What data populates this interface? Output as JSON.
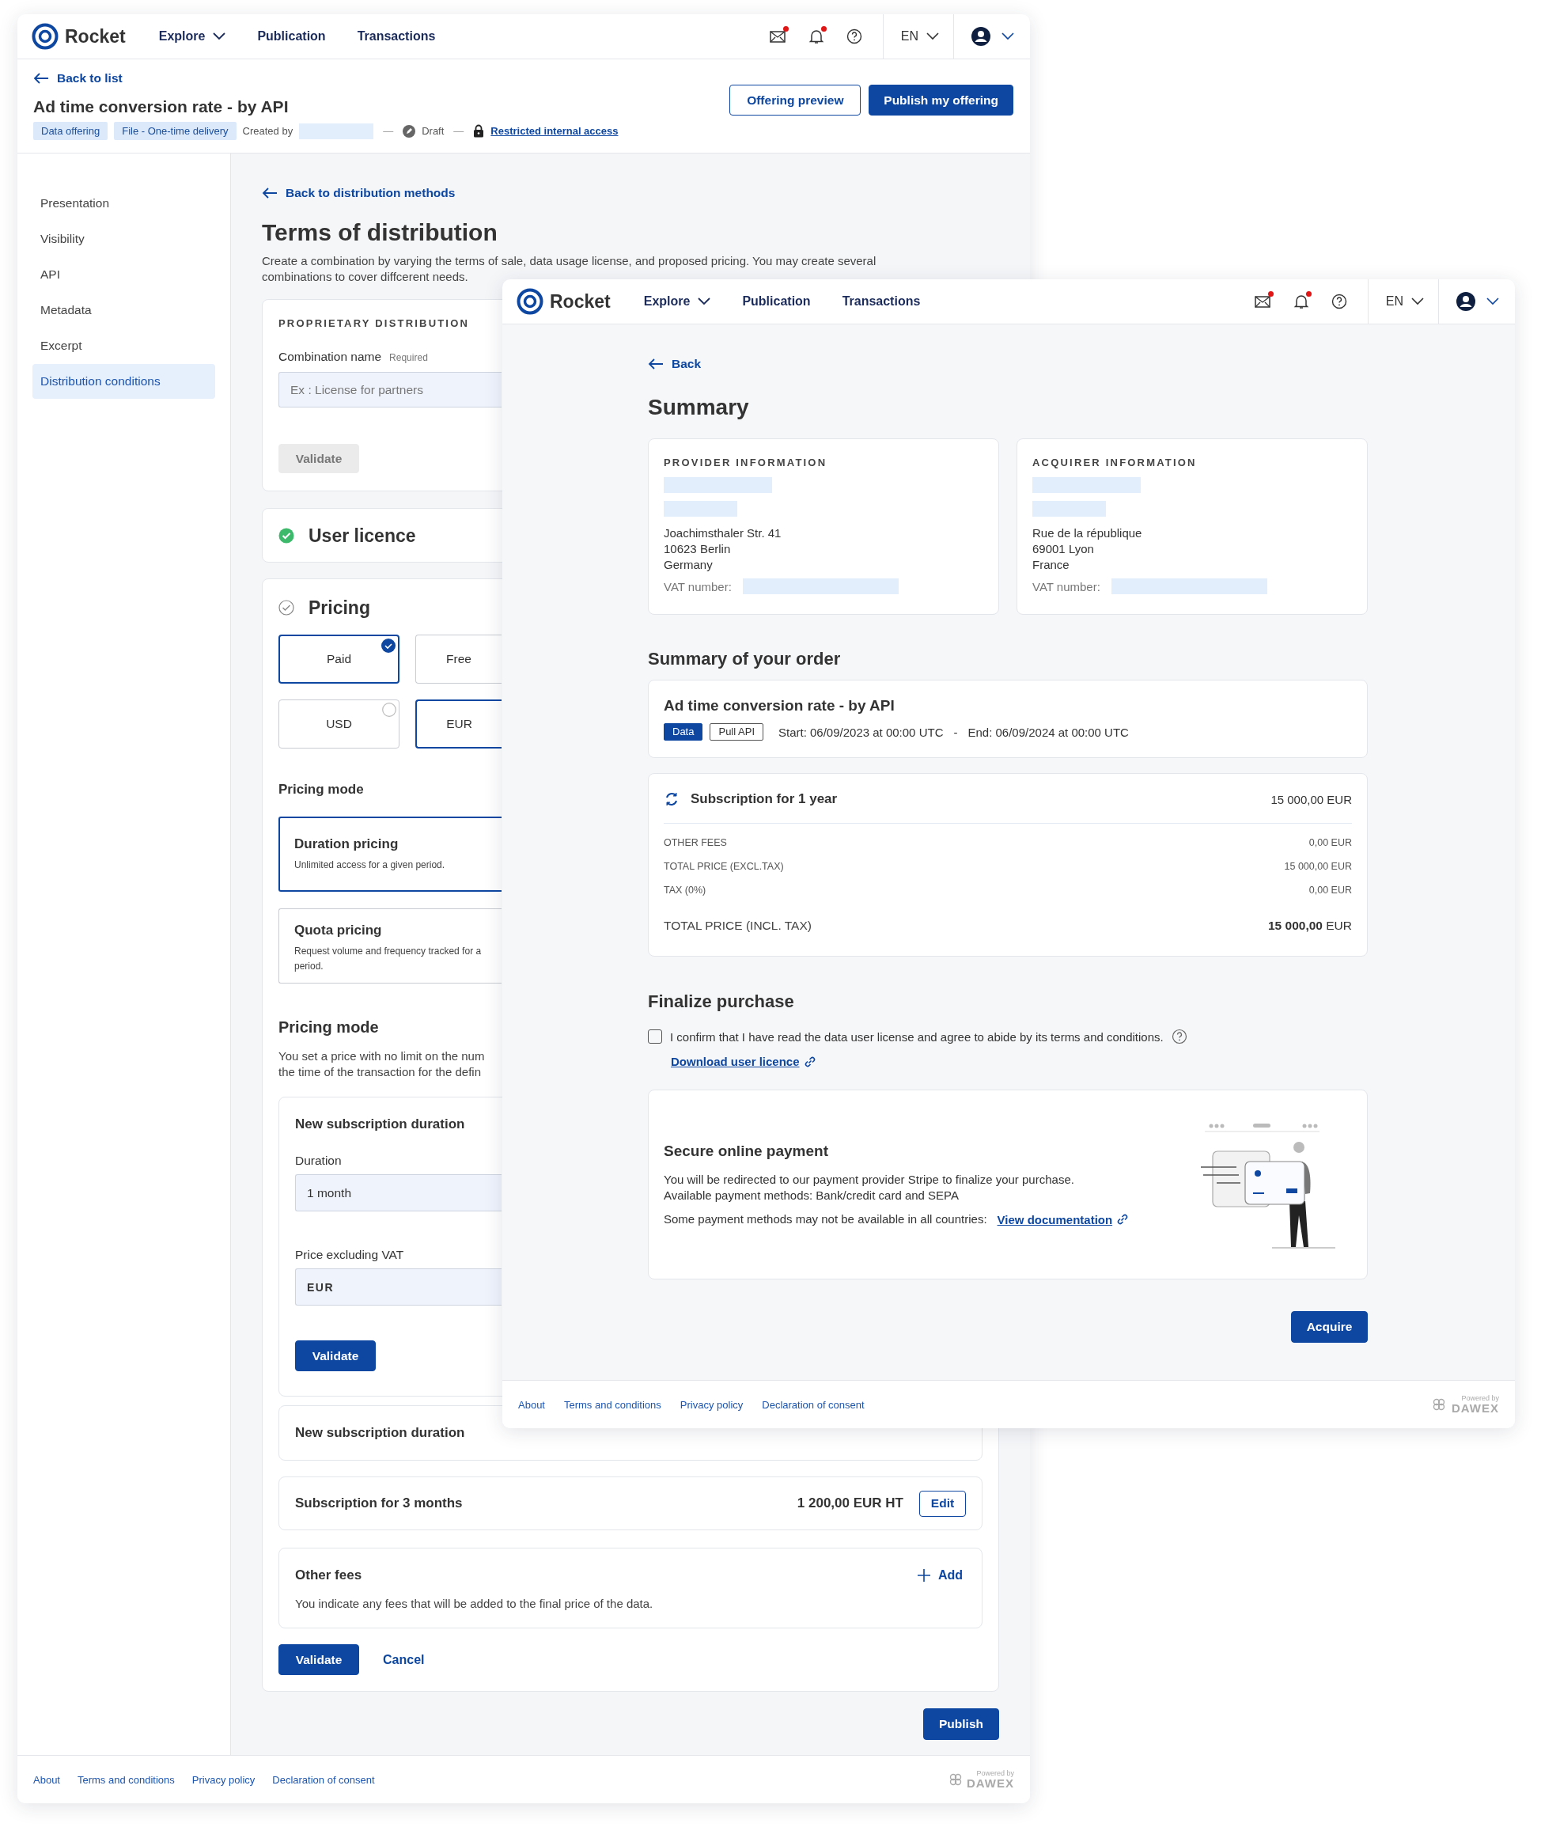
{
  "back_window": {
    "header": {
      "brand": "Rocket",
      "nav": [
        {
          "label": "Explore",
          "dropdown": true
        },
        {
          "label": "Publication",
          "dropdown": false
        },
        {
          "label": "Transactions",
          "dropdown": false
        }
      ],
      "icons": [
        {
          "kind": "mail",
          "unread": true
        },
        {
          "kind": "bell",
          "unread": true
        },
        {
          "kind": "help",
          "unread": false
        }
      ],
      "language": "EN"
    },
    "subheader": {
      "back_link": "Back to list",
      "title": "Ad time conversion rate - by API",
      "meta": [
        {
          "kind": "tag",
          "text": "Data offering"
        },
        {
          "kind": "tag",
          "text": "File - One-time delivery"
        },
        {
          "kind": "label",
          "text": "Created by"
        },
        {
          "kind": "redacted"
        },
        {
          "kind": "separator",
          "text": "—"
        },
        {
          "kind": "status",
          "text": "Draft"
        },
        {
          "kind": "separator",
          "text": "—"
        },
        {
          "kind": "access",
          "text": "Restricted internal access"
        }
      ],
      "buttons": [
        {
          "label": "Offering preview",
          "kind": "outline"
        },
        {
          "label": "Publish my offering",
          "kind": "primary"
        }
      ]
    },
    "sidebar": [
      {
        "label": "Presentation",
        "selected": false
      },
      {
        "label": "Visibility",
        "selected": false
      },
      {
        "label": "API",
        "selected": false
      },
      {
        "label": "Metadata",
        "selected": false
      },
      {
        "label": "Excerpt",
        "selected": false
      },
      {
        "label": "Distribution conditions",
        "selected": true
      }
    ],
    "main": {
      "back_link": "Back to distribution methods",
      "title": "Terms of distribution",
      "intro": "Create a combination by varying the terms of sale, data usage license, and proposed pricing. You may create several combinations to cover diffcerent needs."
    },
    "proprietary": {
      "heading": "PROPRIETARY DISTRIBUTION",
      "field_label": "Combination name",
      "required": "Required",
      "placeholder": "Ex : License for partners",
      "button": "Validate",
      "button_disabled": true
    },
    "user_licence": {
      "title": "User licence",
      "done": true
    },
    "pricing": {
      "title": "Pricing",
      "done": false,
      "options": [
        {
          "label": "Paid",
          "selected": true
        },
        {
          "label": "Free",
          "selected": false
        }
      ],
      "currencies": [
        {
          "label": "USD",
          "selected": false
        },
        {
          "label": "EUR",
          "selected": true
        }
      ],
      "mode_heading": "Pricing mode",
      "modes": [
        {
          "title": "Duration pricing",
          "lines": [
            "Unlimited access for a given period."
          ],
          "selected": true
        },
        {
          "title": "Quota pricing",
          "lines": [
            "Request volume and frequency tracked for a",
            "period."
          ],
          "selected": false
        }
      ],
      "mode2_heading": "Pricing mode",
      "mode2_lines": [
        "You set a price with no limit on the num",
        "the time of the transaction for the defin"
      ],
      "new_subscription": {
        "title": "New subscription duration",
        "duration_label": "Duration",
        "duration_value": "1 month",
        "price_label": "Price excluding VAT",
        "currency": "EUR",
        "button": "Validate"
      },
      "collapsed_title": "New subscription duration",
      "subscription": {
        "title": "Subscription for 3 months",
        "price": "1 200,00 EUR HT",
        "button": "Edit"
      },
      "other_fees": {
        "title": "Other fees",
        "add": "Add",
        "text": "You indicate any fees that will be added to the final price of the data."
      },
      "buttons": [
        {
          "label": "Validate",
          "kind": "primary"
        },
        {
          "label": "Cancel",
          "kind": "link"
        }
      ]
    },
    "publish": "Publish",
    "footer": {
      "links": [
        "About",
        "Terms and conditions",
        "Privacy policy",
        "Declaration of consent"
      ],
      "powered_by": "Powered by",
      "brand": "DAWEX"
    }
  },
  "front_window": {
    "header": {
      "brand": "Rocket",
      "nav": [
        {
          "label": "Explore",
          "dropdown": true
        },
        {
          "label": "Publication",
          "dropdown": false
        },
        {
          "label": "Transactions",
          "dropdown": false
        }
      ],
      "icons": [
        {
          "kind": "mail",
          "unread": true
        },
        {
          "kind": "bell",
          "unread": true
        },
        {
          "kind": "help",
          "unread": false
        }
      ],
      "language": "EN"
    },
    "back_link": "Back",
    "title": "Summary",
    "parties": [
      {
        "heading": "PROVIDER INFORMATION",
        "address": [
          "Joachimsthaler Str. 41",
          "10623 Berlin",
          "Germany"
        ],
        "vat_label": "VAT number:"
      },
      {
        "heading": "ACQUIRER INFORMATION",
        "address": [
          "Rue de la république",
          "69001 Lyon",
          "France"
        ],
        "vat_label": "VAT number:"
      }
    ],
    "order_heading": "Summary of your order",
    "product": {
      "title": "Ad time conversion rate - by API",
      "tags": [
        {
          "label": "Data",
          "kind": "filled"
        },
        {
          "label": "Pull API",
          "kind": "outline"
        }
      ],
      "start": "Start: 06/09/2023 at 00:00 UTC",
      "separator": "-",
      "end": "End: 06/09/2024 at 00:00 UTC"
    },
    "price": {
      "title": "Subscription for 1 year",
      "amount": "15 000,00 EUR",
      "lines": [
        {
          "label": "OTHER FEES",
          "value": "0,00 EUR"
        },
        {
          "label": "TOTAL PRICE (EXCL.TAX)",
          "value": "15 000,00 EUR"
        },
        {
          "label": "TAX (0%)",
          "value": "0,00 EUR"
        }
      ],
      "total_label": "TOTAL PRICE (INCL. TAX)",
      "total_value": "**15 000,00** EUR"
    },
    "finalize": {
      "heading": "Finalize purchase",
      "consent": "I confirm that I have read the data user license and agree to abide by its terms and conditions.",
      "checked": false,
      "download_link": "Download user licence"
    },
    "payment": {
      "title": "Secure online payment",
      "lines": [
        "You will be redirected to our payment provider Stripe to finalize your purchase.",
        "Available payment methods: Bank/credit card and SEPA"
      ],
      "note": "Some payment methods may not be available in all countries:",
      "doc_link": "View documentation"
    },
    "acquire": "Acquire",
    "footer": {
      "links": [
        "About",
        "Terms and conditions",
        "Privacy policy",
        "Declaration of consent"
      ],
      "powered_by": "Powered by",
      "brand": "DAWEX"
    }
  }
}
